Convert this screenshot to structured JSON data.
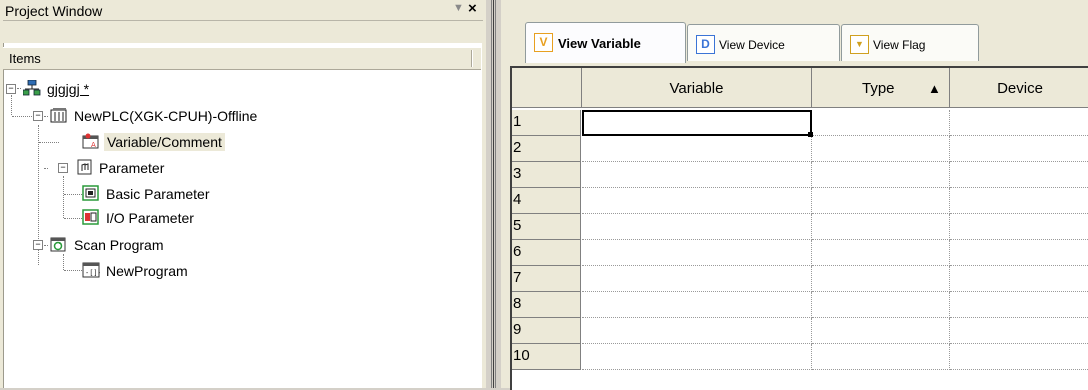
{
  "project_window": {
    "title": "Project Window",
    "dropdown_glyph": "▼",
    "close_glyph": "×",
    "items_header": "Items",
    "tree": [
      {
        "label": "gjgjgj *",
        "icon": "network-icon",
        "expanded": true
      },
      {
        "label": "NewPLC(XGK-CPUH)-Offline",
        "icon": "plc-icon",
        "expanded": true
      },
      {
        "label": "Variable/Comment",
        "icon": "variable-comment-icon",
        "selected": true
      },
      {
        "label": "Parameter",
        "icon": "parameter-icon",
        "expanded": true
      },
      {
        "label": "Basic Parameter",
        "icon": "basic-parameter-icon"
      },
      {
        "label": "I/O Parameter",
        "icon": "io-parameter-icon"
      },
      {
        "label": "Scan Program",
        "icon": "scan-program-icon",
        "expanded": true
      },
      {
        "label": "NewProgram",
        "icon": "program-icon"
      }
    ],
    "expand_glyph": "−"
  },
  "tabs": [
    {
      "label": "View Variable",
      "icon_letter": "V",
      "icon_color": "#e8a020",
      "active": true
    },
    {
      "label": "View Device",
      "icon_letter": "D",
      "icon_color": "#3b74d6",
      "active": false
    },
    {
      "label": "View Flag",
      "icon_letter": "▼",
      "icon_color": "#d0a020",
      "active": false
    }
  ],
  "grid": {
    "columns": [
      {
        "label": "Variable",
        "sort": ""
      },
      {
        "label": "Type",
        "sort": "▲"
      },
      {
        "label": "Device",
        "sort": ""
      }
    ],
    "row_numbers": [
      "1",
      "2",
      "3",
      "4",
      "5",
      "6",
      "7",
      "8",
      "9",
      "10"
    ]
  }
}
